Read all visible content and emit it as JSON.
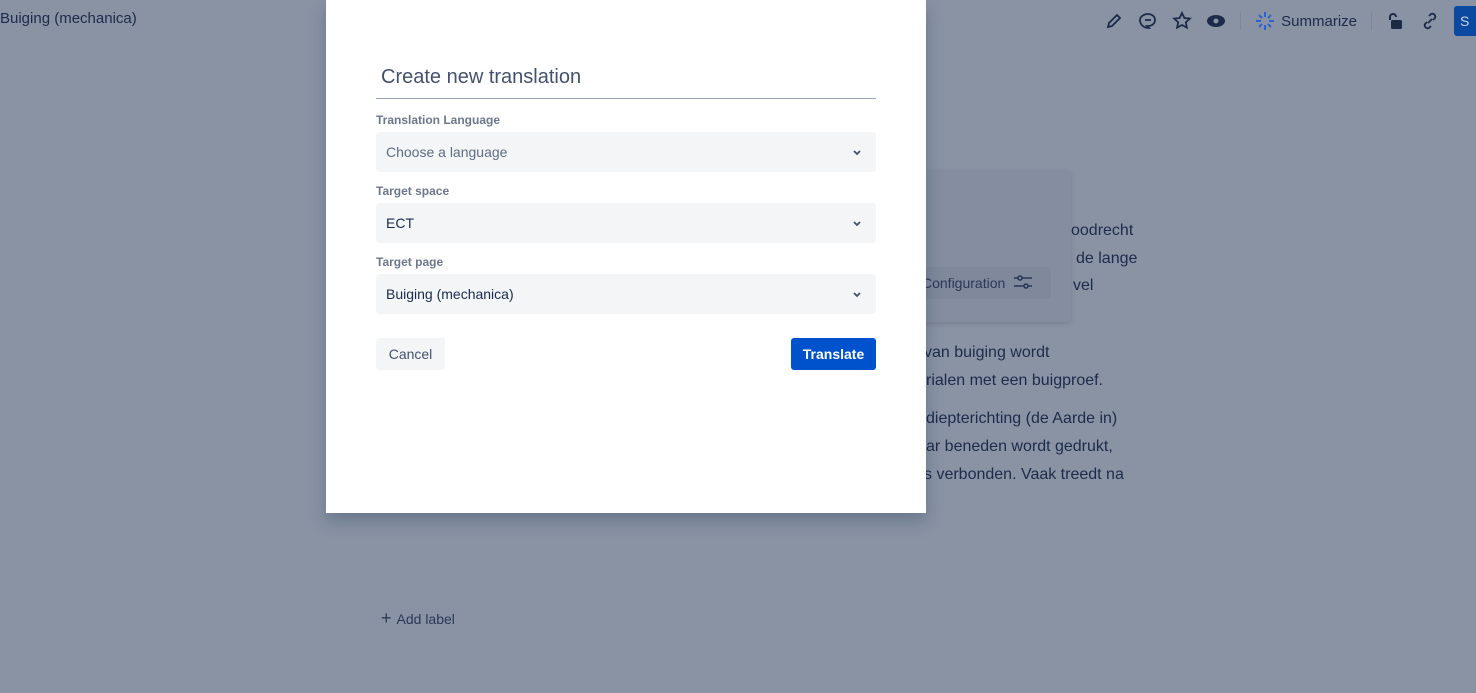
{
  "page": {
    "title": "Buiging (mechanica)",
    "add_label": "Add label"
  },
  "toolbar": {
    "summarize": "Summarize",
    "share": "S",
    "icons": [
      "pencil-icon",
      "comment-icon",
      "star-icon",
      "eye-icon",
      "sparkle-icon",
      "unlock-icon",
      "link-icon"
    ]
  },
  "card": {
    "config_label": "Configuration"
  },
  "background_text": [
    "oodrecht",
    "de lange",
    "vel",
    "van buiging wordt",
    "rialen met een buigproef.",
    "diepterichting (de Aarde in)",
    "ar beneden wordt gedrukt,",
    "s verbonden. Vaak treedt na"
  ],
  "modal": {
    "title": "Create new translation",
    "fields": [
      {
        "label": "Translation Language",
        "value": "Choose a language",
        "placeholder": true
      },
      {
        "label": "Target space",
        "value": "ECT"
      },
      {
        "label": "Target page",
        "value": "Buiging (mechanica)"
      }
    ],
    "cancel": "Cancel",
    "translate": "Translate"
  },
  "colors": {
    "primary": "#0052cc",
    "overlay": "#8993a4"
  }
}
